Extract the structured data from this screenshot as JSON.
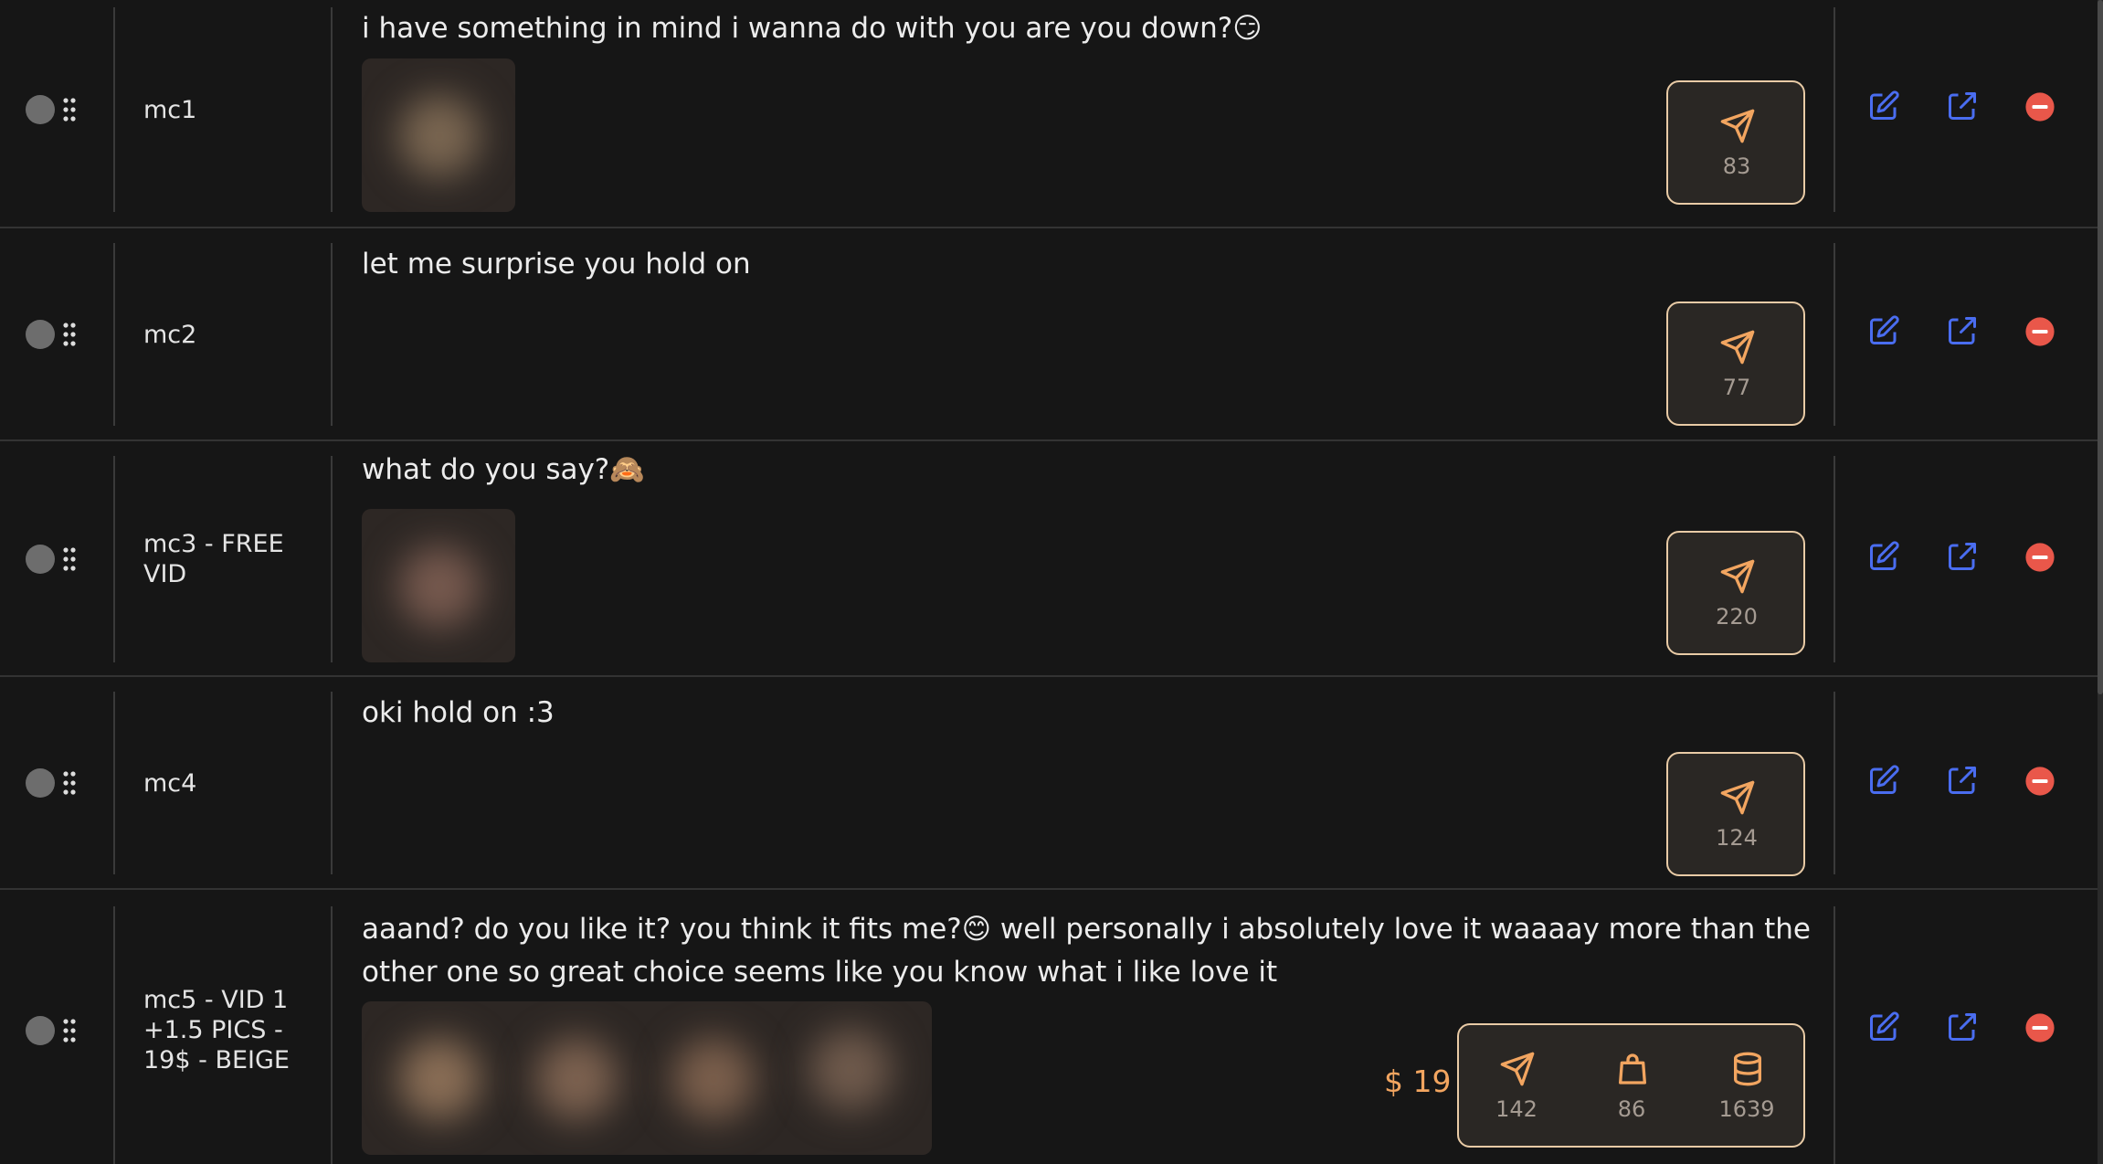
{
  "rows": [
    {
      "label": "mc1",
      "message": "i have something in mind i wanna do with you are you down?😏",
      "stats": [
        {
          "icon": "send-icon",
          "count": "83"
        }
      ]
    },
    {
      "label": "mc2",
      "message": "let me surprise you hold on",
      "stats": [
        {
          "icon": "send-icon",
          "count": "77"
        }
      ]
    },
    {
      "label": "mc3 - FREE VID",
      "message": "what do you say?🙈",
      "stats": [
        {
          "icon": "send-icon",
          "count": "220"
        }
      ]
    },
    {
      "label": "mc4",
      "message": "oki hold on :3",
      "stats": [
        {
          "icon": "send-icon",
          "count": "124"
        }
      ]
    },
    {
      "label": "mc5 - VID 1 +1.5 PICS - 19$ - BEIGE",
      "message": "aaand? do you like it? you think it fits me?😊 well personally i absolutely love it waaaay more than the other one so great choice seems like you know what i like love it",
      "price": "$ 19",
      "stats": [
        {
          "icon": "send-icon",
          "count": "142"
        },
        {
          "icon": "shopping-bag-icon",
          "count": "86"
        },
        {
          "icon": "database-icon",
          "count": "1639"
        }
      ]
    }
  ],
  "actions": [
    "edit-icon",
    "share-icon",
    "delete-icon"
  ],
  "colors": {
    "background": "#161616",
    "accent_orange": "#f2a560",
    "action_blue": "#4a6df0",
    "delete_red": "#e9574a",
    "stat_border": "#e9cba6"
  }
}
